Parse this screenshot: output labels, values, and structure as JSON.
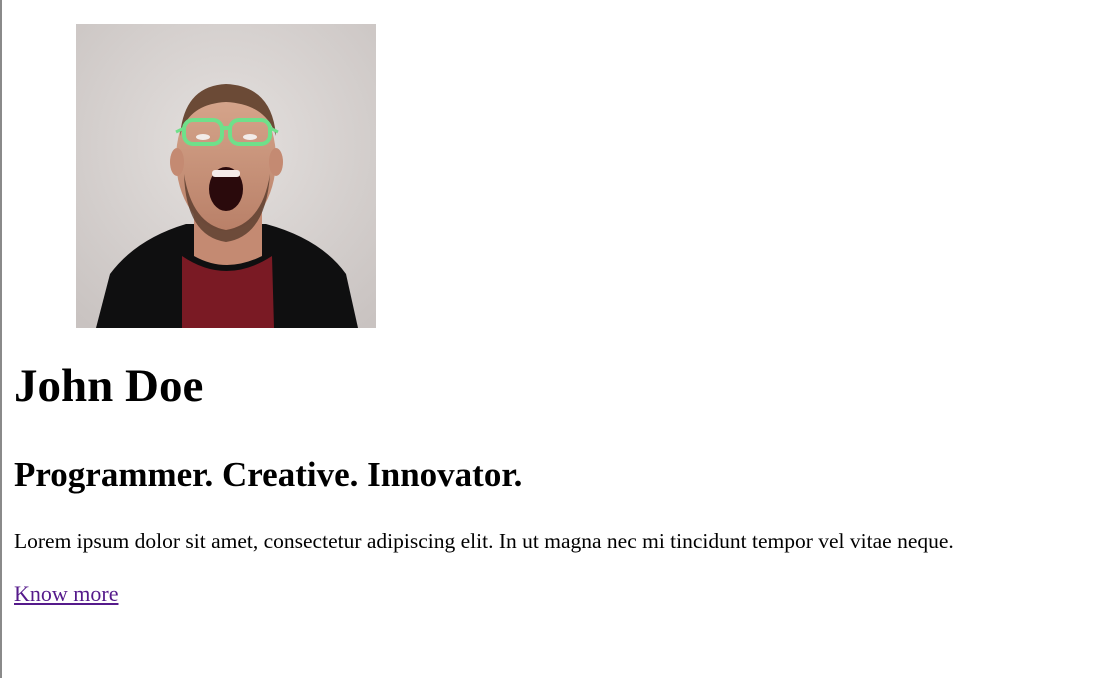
{
  "profile": {
    "portrait_alt": "portrait",
    "name": "John Doe",
    "tagline": "Programmer. Creative. Innovator.",
    "bio": "Lorem ipsum dolor sit amet, consectetur adipiscing elit. In ut magna nec mi tincidunt tempor vel vitae neque.",
    "link_label": "Know more"
  },
  "colors": {
    "link_visited": "#551a8b",
    "glasses": "#6fe08a",
    "shirt": "#7a1a24",
    "jacket": "#101010"
  }
}
